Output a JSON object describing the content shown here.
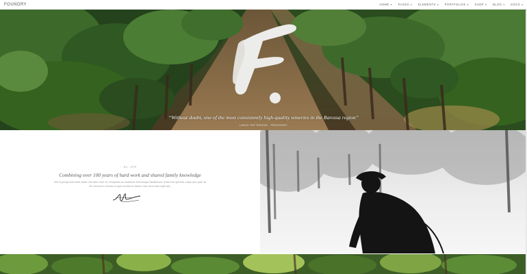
{
  "header": {
    "logo": "FOUNDRY",
    "nav": [
      {
        "label": "HOME",
        "icon": "chevron-down-icon"
      },
      {
        "label": "PAGES",
        "icon": "chevron-down-icon"
      },
      {
        "label": "ELEMENTS",
        "icon": "chevron-down-icon"
      },
      {
        "label": "PORTFOLIOS",
        "icon": "chevron-down-icon"
      },
      {
        "label": "SHOP",
        "icon": "chevron-down-icon"
      },
      {
        "label": "BLOG",
        "icon": "chevron-down-icon"
      },
      {
        "label": "DOCS",
        "icon": "chevron-down-icon"
      }
    ]
  },
  "hero": {
    "brand_mark": "F.",
    "quote": "“Without doubt, one of the most consistently high-quality wineries in the Barossa region”",
    "credit": "LANCE PATTERSON · PRESIDENT"
  },
  "story": {
    "eyebrow": "Est. 1918",
    "title": "Combining over 100 years of hard work and shared family knowledge",
    "body": "Sed ut perspiciatis unde omnis iste natus error sit voluptatem accusantium doloremque laudantium, totam rem aperiam, eaque ipsa quae ab illo inventore veritatis et quasi architecto beatae vitae dicta sunt explicabo."
  },
  "colors": {
    "vine_dark": "#1f3a1a",
    "vine_mid": "#3d6a2b",
    "soil": "#8a6a45",
    "mist": "#e9e9e9",
    "silhouette": "#141414"
  }
}
